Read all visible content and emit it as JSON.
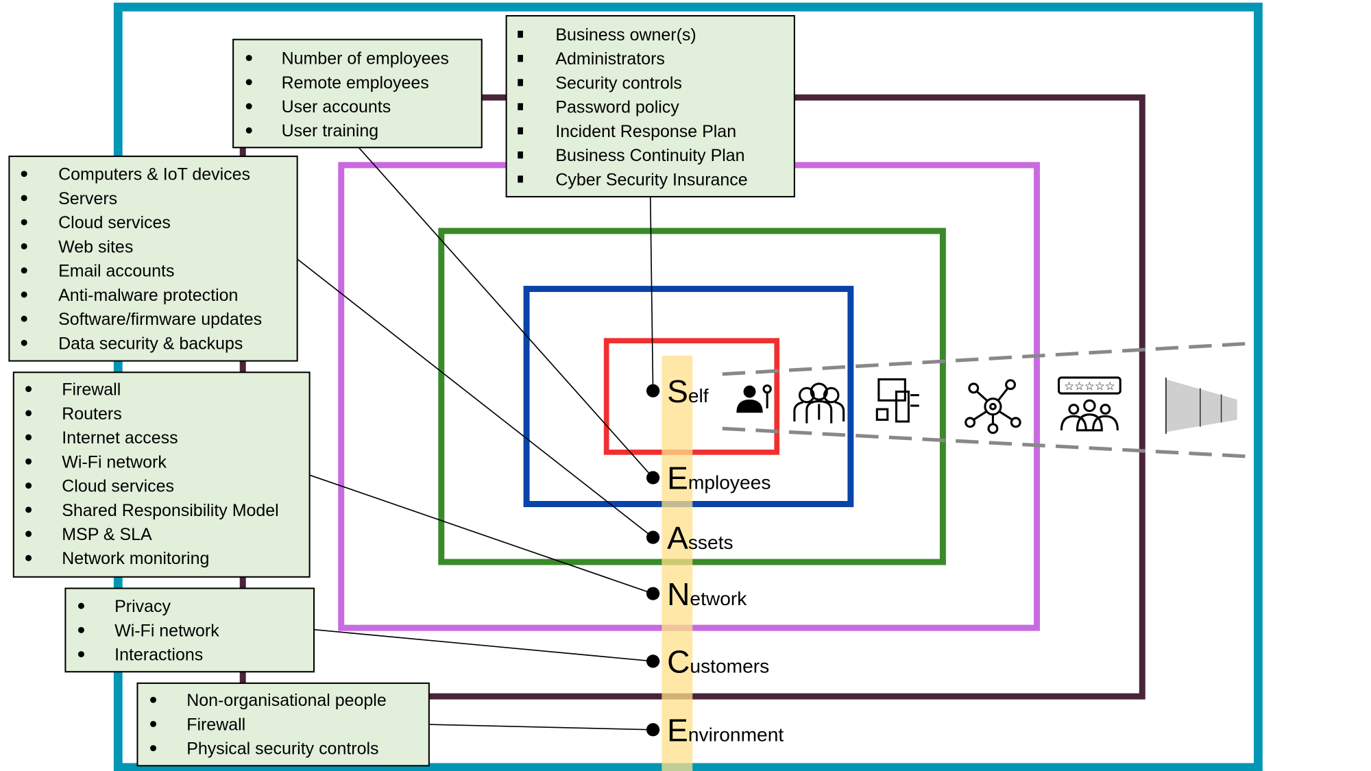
{
  "colors": {
    "environment": "#0096b4",
    "customers": "#4a2438",
    "network": "#c86be0",
    "assets": "#3a8a2a",
    "employees": "#0a44a8",
    "self": "#f03030",
    "strip": "#ffe08a",
    "box_fill": "#e2efda"
  },
  "layers": [
    {
      "initial": "S",
      "rest": "elf"
    },
    {
      "initial": "E",
      "rest": "mployees"
    },
    {
      "initial": "A",
      "rest": "ssets"
    },
    {
      "initial": "N",
      "rest": "etwork"
    },
    {
      "initial": "C",
      "rest": "ustomers"
    },
    {
      "initial": "E",
      "rest": "nvironment"
    }
  ],
  "icons": [
    "person-key-icon",
    "employees-group-icon",
    "devices-icon",
    "network-hub-icon",
    "customer-review-icon",
    "fence-icon"
  ],
  "boxes": {
    "employees": [
      "Number of employees",
      "Remote employees",
      "User accounts",
      "User training"
    ],
    "self": [
      "Business owner(s)",
      "Administrators",
      "Security controls",
      "Password policy",
      "Incident Response Plan",
      "Business Continuity Plan",
      "Cyber Security Insurance"
    ],
    "assets": [
      "Computers & IoT devices",
      "Servers",
      "Cloud services",
      "Web sites",
      "Email accounts",
      "Anti-malware protection",
      "Software/firmware updates",
      "Data security & backups"
    ],
    "network": [
      "Firewall",
      "Routers",
      "Internet access",
      "Wi-Fi network",
      "Cloud services",
      "Shared Responsibility Model",
      "MSP & SLA",
      "Network monitoring"
    ],
    "customers": [
      "Privacy",
      "Wi-Fi network",
      "Interactions"
    ],
    "environment": [
      "Non-organisational people",
      "Firewall",
      "Physical security controls"
    ]
  }
}
